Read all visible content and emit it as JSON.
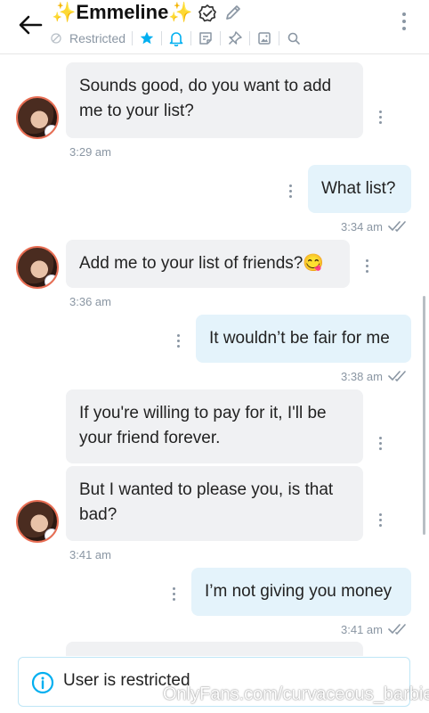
{
  "header": {
    "spark_left": "✨",
    "name": "Emmeline",
    "spark_right": "✨",
    "status": "Restricted",
    "icons": [
      "back-arrow-icon",
      "verified-icon",
      "pencil-icon",
      "restricted-icon",
      "star-icon",
      "bell-icon",
      "note-icon",
      "pin-icon",
      "gallery-icon",
      "search-icon",
      "more-vertical-icon"
    ],
    "accent": "#00aff0"
  },
  "messages": [
    {
      "id": "m1",
      "direction": "in",
      "text": "Sounds good, do you want to add me to your list?",
      "time": "3:29 am"
    },
    {
      "id": "m2",
      "direction": "out",
      "text": "What list?",
      "time": "3:34 am"
    },
    {
      "id": "m3",
      "direction": "in",
      "text": "Add me to your list of friends?😋",
      "time": "3:36 am"
    },
    {
      "id": "m4",
      "direction": "out",
      "text": "It wouldn’t be fair for me",
      "time": "3:38 am"
    },
    {
      "id": "m5",
      "direction": "in",
      "text": "If you're willing to pay for it, I'll be your friend forever."
    },
    {
      "id": "m6",
      "direction": "in",
      "text": "But I wanted to please you, is that bad?",
      "time": "3:41 am"
    },
    {
      "id": "m7",
      "direction": "out",
      "text": "I’m not giving you money",
      "time": "3:41 am"
    }
  ],
  "banner": {
    "text": "User is restricted"
  },
  "watermark": "OnlyFans.com/curvaceous_barbie"
}
